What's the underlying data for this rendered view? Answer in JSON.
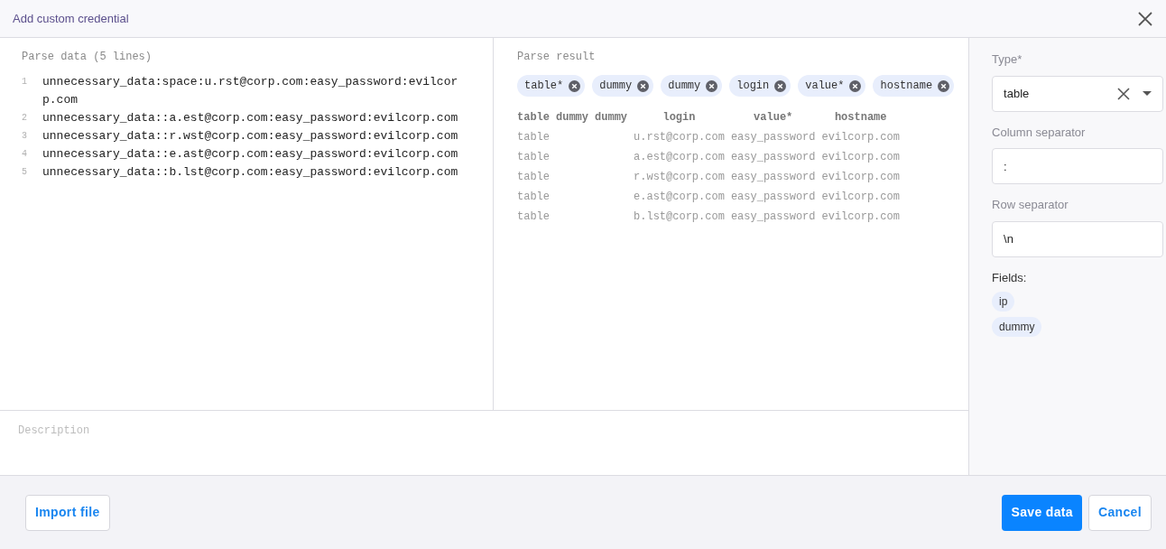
{
  "window": {
    "title": "Add custom credential"
  },
  "parse_data": {
    "title": "Parse data (5 lines)",
    "lines": [
      {
        "number": "1",
        "text": "unnecessary_data:space:u.rst@corp.com:easy_password:evilcorp.com"
      },
      {
        "number": "2",
        "text": "unnecessary_data::a.est@corp.com:easy_password:evilcorp.com"
      },
      {
        "number": "3",
        "text": "unnecessary_data::r.wst@corp.com:easy_password:evilcorp.com"
      },
      {
        "number": "4",
        "text": "unnecessary_data::e.ast@corp.com:easy_password:evilcorp.com"
      },
      {
        "number": "5",
        "text": "unnecessary_data::b.lst@corp.com:easy_password:evilcorp.com"
      }
    ]
  },
  "parse_result": {
    "title": "Parse result",
    "chips": [
      "table*",
      "dummy",
      "dummy",
      "login",
      "value*",
      "hostname"
    ],
    "table": {
      "columns": [
        "table",
        "dummy",
        "dummy",
        "login",
        "value*",
        "hostname"
      ],
      "rows": [
        [
          "table",
          null,
          null,
          "u.rst@corp.com",
          "easy_password",
          "evilcorp.com"
        ],
        [
          "table",
          null,
          null,
          "a.est@corp.com",
          "easy_password",
          "evilcorp.com"
        ],
        [
          "table",
          null,
          null,
          "r.wst@corp.com",
          "easy_password",
          "evilcorp.com"
        ],
        [
          "table",
          null,
          null,
          "e.ast@corp.com",
          "easy_password",
          "evilcorp.com"
        ],
        [
          "table",
          null,
          null,
          "b.lst@corp.com",
          "easy_password",
          "evilcorp.com"
        ]
      ]
    }
  },
  "description": {
    "placeholder": "Description"
  },
  "settings": {
    "type": {
      "label": "Type*",
      "value": "table"
    },
    "column_separator": {
      "label": "Column separator",
      "value": ":"
    },
    "row_separator": {
      "label": "Row separator",
      "value": "\\n"
    },
    "fields_label": "Fields:",
    "fields": [
      "ip",
      "dummy"
    ]
  },
  "footer": {
    "import_button": "Import file",
    "save_button": "Save data",
    "cancel_button": "Cancel"
  }
}
